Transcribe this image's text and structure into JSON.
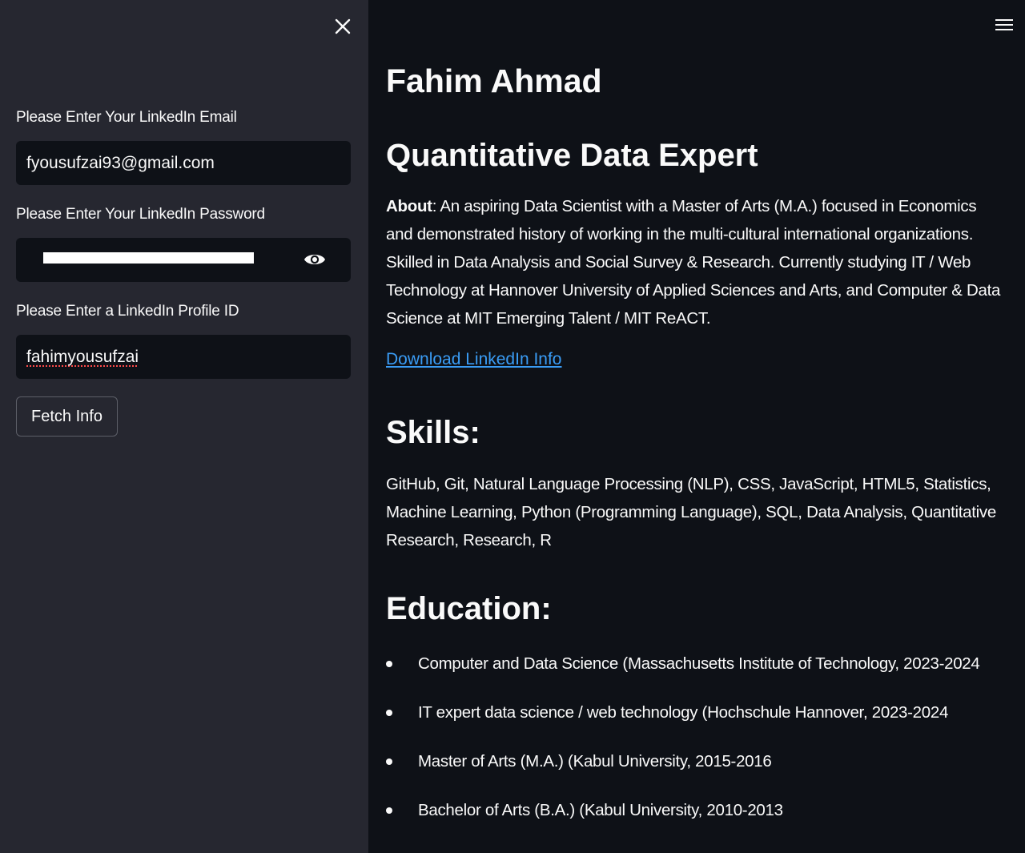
{
  "sidebar": {
    "email": {
      "label": "Please Enter Your LinkedIn Email",
      "value": "fyousufzai93@gmail.com"
    },
    "password": {
      "label": "Please Enter Your LinkedIn Password"
    },
    "profile_id": {
      "label": "Please Enter a LinkedIn Profile ID",
      "value": "fahimyousufzai"
    },
    "fetch_button_label": "Fetch Info"
  },
  "main": {
    "name": "Fahim Ahmad",
    "headline": "Quantitative Data Expert",
    "about_label": "About",
    "about_text": ": An aspiring Data Scientist with a Master of Arts (M.A.) focused in Economics and demonstrated history of working in the multi-cultural international organizations. Skilled in Data Analysis and Social Survey & Research. Currently studying IT / Web Technology at Hannover University of Applied Sciences and Arts, and Computer & Data Science at MIT Emerging Talent / MIT ReACT.",
    "download_link": "Download LinkedIn Info",
    "skills_heading": "Skills:",
    "skills_text": "GitHub, Git, Natural Language Processing (NLP), CSS, JavaScript, HTML5, Statistics, Machine Learning, Python (Programming Language), SQL, Data Analysis, Quantitative Research, Research, R",
    "education_heading": "Education:",
    "education": [
      "Computer and Data Science (Massachusetts Institute of Technology, 2023-2024",
      "IT expert data science / web technology (Hochschule Hannover, 2023-2024",
      "Master of Arts (M.A.) (Kabul University, 2015-2016",
      "Bachelor of Arts (B.A.) (Kabul University, 2010-2013"
    ]
  },
  "colors": {
    "sidebar_bg": "#262730",
    "main_bg": "#0e1117",
    "link": "#3a9cf5",
    "text": "#fafafa"
  },
  "icons": {
    "close": "close-icon",
    "eye": "eye-icon",
    "menu": "hamburger-menu-icon"
  }
}
